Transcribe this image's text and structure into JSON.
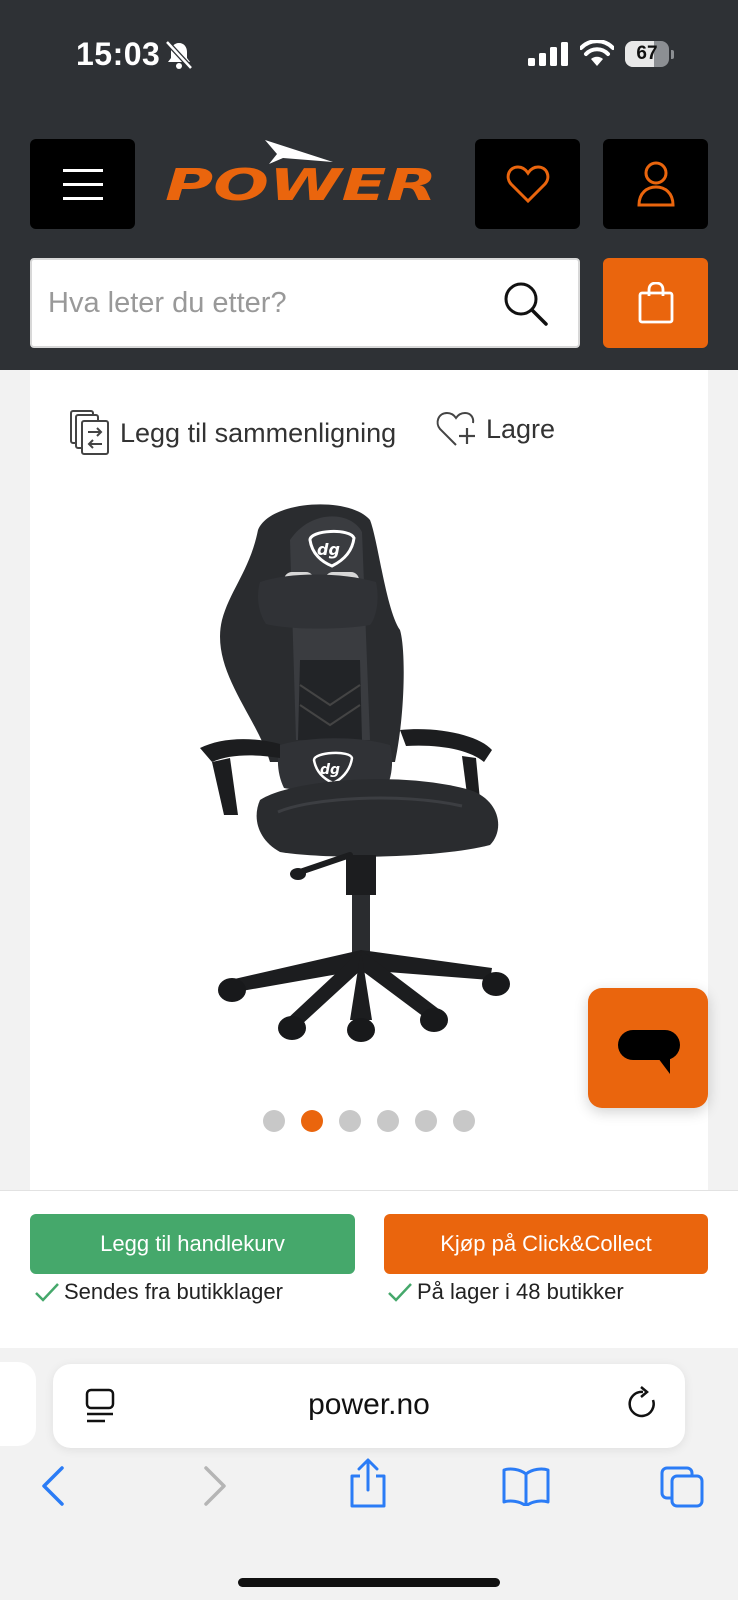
{
  "status_bar": {
    "time": "15:03",
    "battery": "67",
    "battery_level": 0.67,
    "icons": [
      "bell-slash-icon",
      "signal-icon",
      "wifi-icon",
      "battery-icon"
    ]
  },
  "header": {
    "logo_text": "POWER",
    "search": {
      "placeholder": "Hva leter du etter?"
    },
    "colors": {
      "brand_orange": "#ea650d",
      "header_bg": "#2e3135"
    }
  },
  "product": {
    "compare_label": "Legg til sammenligning",
    "save_label": "Lagre",
    "image_alt": "dg gaming chair",
    "carousel": {
      "total": 6,
      "active_index": 1
    }
  },
  "actions": {
    "add_to_cart_label": "Legg til handlekurv",
    "click_collect_label": "Kjøp på Click&Collect",
    "add_to_cart_note": "Sendes fra butikklager",
    "click_collect_note": "På lager i 48 butikker",
    "colors": {
      "green": "#45a86b",
      "orange": "#ea650d"
    }
  },
  "browser": {
    "url": "power.no",
    "toolbar": [
      "back-icon",
      "forward-icon",
      "share-icon",
      "bookmarks-icon",
      "tabs-icon"
    ]
  }
}
